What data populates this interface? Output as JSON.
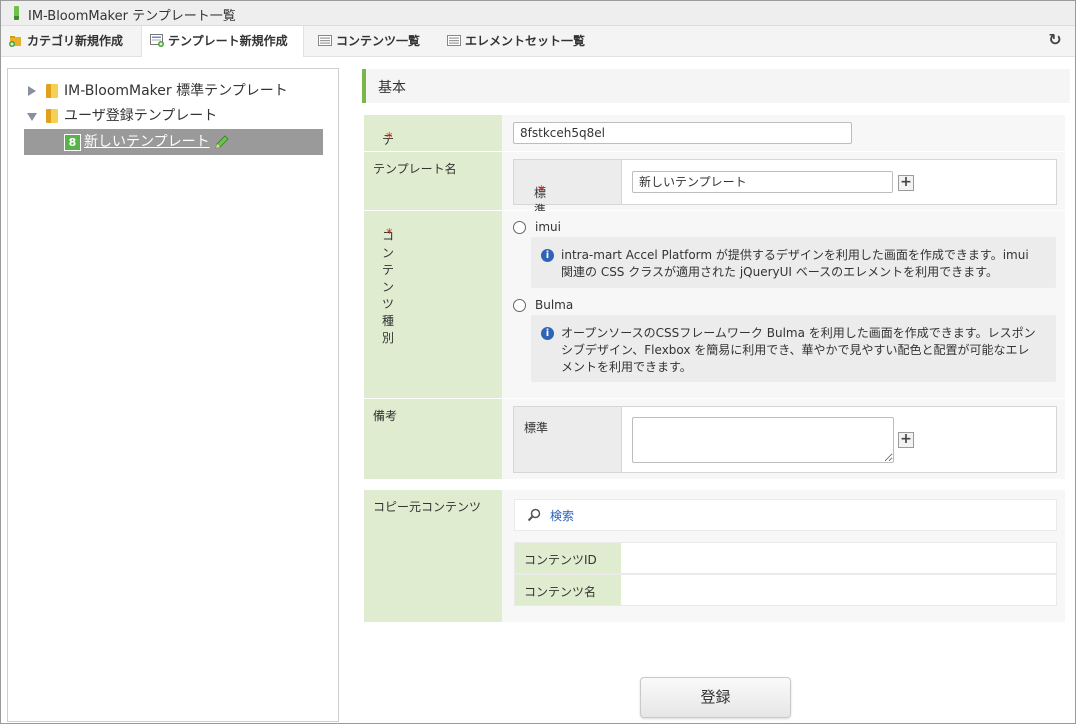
{
  "window": {
    "title": "IM-BloomMaker テンプレート一覧"
  },
  "tabs": [
    {
      "label": "カテゴリ新規作成",
      "icon": "folder-add-icon"
    },
    {
      "label": "テンプレート新規作成",
      "icon": "template-add-icon",
      "active": true
    },
    {
      "label": "コンテンツ一覧",
      "icon": "list-icon"
    },
    {
      "label": "エレメントセット一覧",
      "icon": "list-icon"
    }
  ],
  "toolbar": {
    "refresh_icon": "refresh-icon"
  },
  "tree": {
    "items": [
      {
        "label": "IM-BloomMaker 標準テンプレート",
        "expanded": false
      },
      {
        "label": "ユーザ登録テンプレート",
        "expanded": true
      },
      {
        "label": "新しいテンプレート",
        "badge": "8",
        "selected": true
      }
    ]
  },
  "form": {
    "section_title": "基本",
    "template_id": {
      "label": "テンプレートID",
      "required": "*",
      "value": "8fstkceh5q8el"
    },
    "template_name": {
      "label": "テンプレート名",
      "locale_label": "標準",
      "required": "*",
      "value": "新しいテンプレート"
    },
    "content_type": {
      "label": "コンテンツ種別",
      "required": "*",
      "options": [
        {
          "label": "imui",
          "description": "intra-mart Accel Platform が提供するデザインを利用した画面を作成できます。imui 関連の CSS クラスが適用された jQueryUI ベースのエレメントを利用できます。"
        },
        {
          "label": "Bulma",
          "description": "オープンソースのCSSフレームワーク Bulma を利用した画面を作成できます。レスポンシブデザイン、Flexbox を簡易に利用でき、華やかで見やすい配色と配置が可能なエレメントを利用できます。"
        }
      ]
    },
    "note": {
      "label": "備考",
      "locale_label": "標準",
      "value": ""
    },
    "copy_source": {
      "label": "コピー元コンテンツ",
      "search_label": "検索",
      "content_id_label": "コンテンツID",
      "content_id_value": "",
      "content_name_label": "コンテンツ名",
      "content_name_value": ""
    },
    "submit_label": "登録"
  },
  "colors": {
    "label_bg": "#dfeccf",
    "accent": "#7ab648",
    "link": "#2a62b8",
    "required": "#d9251c"
  }
}
